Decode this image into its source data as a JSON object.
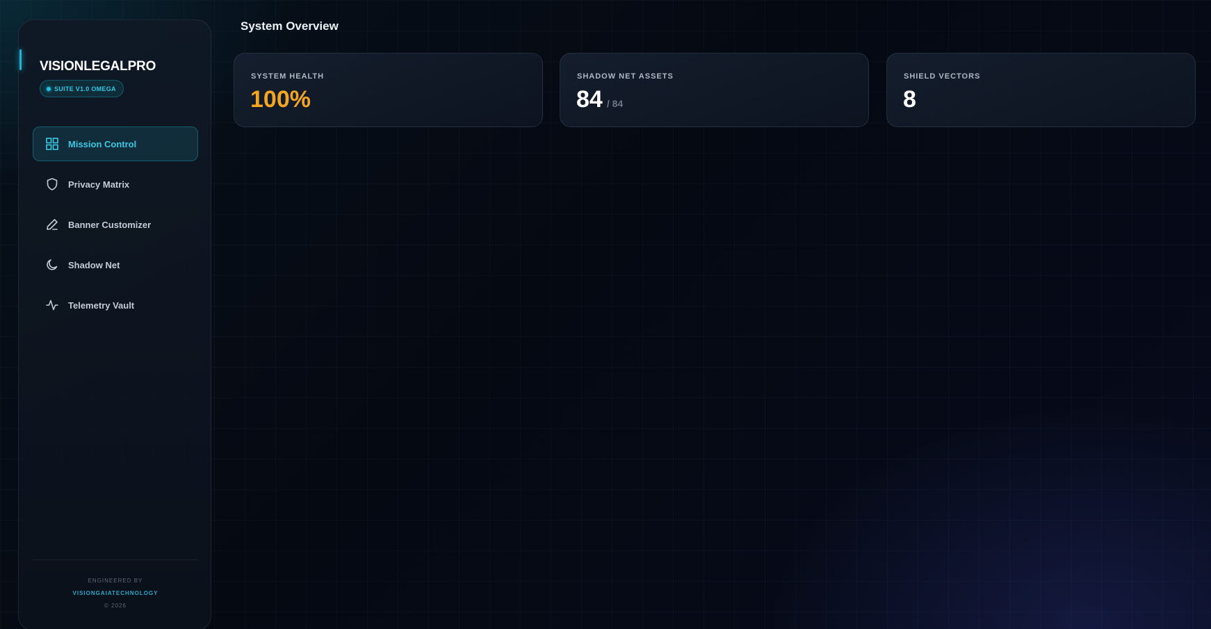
{
  "sidebar": {
    "brand": "VISIONLEGALPRO",
    "version_badge": "SUITE V1.0 OMEGA",
    "nav": [
      {
        "label": "Mission Control",
        "icon": "grid-icon",
        "active": true
      },
      {
        "label": "Privacy Matrix",
        "icon": "shield-icon",
        "active": false
      },
      {
        "label": "Banner Customizer",
        "icon": "pencil-icon",
        "active": false
      },
      {
        "label": "Shadow Net",
        "icon": "moon-icon",
        "active": false
      },
      {
        "label": "Telemetry Vault",
        "icon": "activity-icon",
        "active": false
      }
    ],
    "footer": {
      "engineered_by": "ENGINEERED BY",
      "company": "VISIONGAIATECHNOLOGY",
      "year": "© 2026"
    }
  },
  "main": {
    "title": "System Overview",
    "cards": [
      {
        "label": "SYSTEM HEALTH",
        "value": "100%",
        "sub": ""
      },
      {
        "label": "SHADOW NET ASSETS",
        "value": "84",
        "sub": "/ 84"
      },
      {
        "label": "SHIELD VECTORS",
        "value": "8",
        "sub": ""
      }
    ]
  },
  "colors": {
    "accent": "#1fb6d6",
    "health_value": "#f5a524",
    "background": "#050912"
  }
}
